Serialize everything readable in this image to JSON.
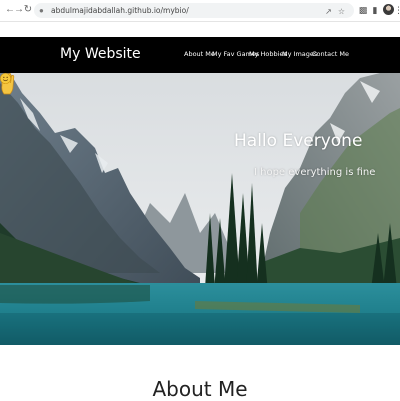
{
  "browser": {
    "url": "abdulmajidabdallah.github.io/mybio/",
    "back_icon": "arrow-left",
    "forward_icon": "arrow-right",
    "reload_icon": "reload"
  },
  "navbar": {
    "brand": "My Website",
    "links": [
      "About Me",
      "My Fav Games",
      "My Hobbies",
      "My Images",
      "Contact Me"
    ],
    "background": "#000000"
  },
  "hero": {
    "title": "Hallo Everyone",
    "subtitle": "I hope everything is fine",
    "title_icon": "waving-hand",
    "subtitle_icon": "smiling-face"
  },
  "about": {
    "title": "About Me"
  }
}
